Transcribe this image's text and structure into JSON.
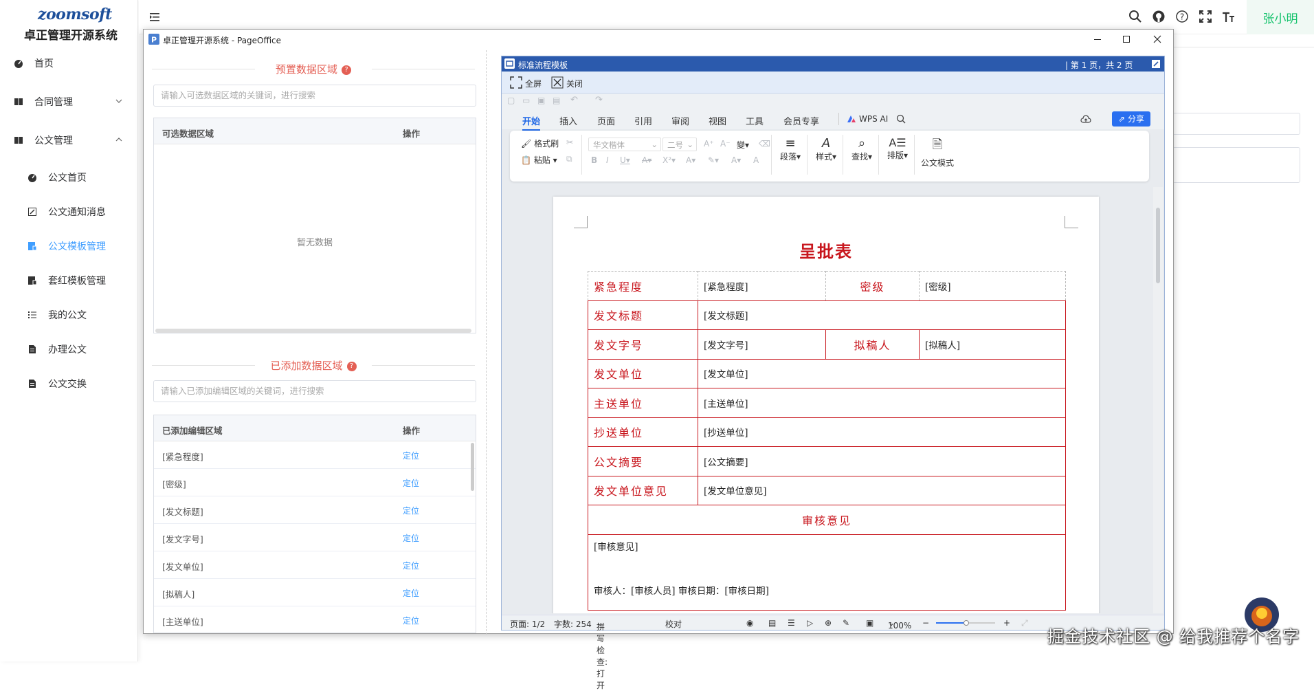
{
  "app": {
    "logo_text": "zoomsoft",
    "title": "卓正管理开源系统",
    "user_name": "张小明"
  },
  "sidebar": {
    "items": [
      {
        "label": "首页",
        "icon": "dashboard-icon"
      },
      {
        "label": "合同管理",
        "icon": "book-icon",
        "expandable": true,
        "expanded": false
      },
      {
        "label": "公文管理",
        "icon": "book-icon",
        "expandable": true,
        "expanded": true
      },
      {
        "label": "公文首页",
        "icon": "dashboard-icon",
        "sub": true
      },
      {
        "label": "公文通知消息",
        "icon": "edit-icon",
        "sub": true
      },
      {
        "label": "公文模板管理",
        "icon": "template-icon",
        "sub": true,
        "active": true
      },
      {
        "label": "套红模板管理",
        "icon": "template-icon",
        "sub": true
      },
      {
        "label": "我的公文",
        "icon": "list-icon",
        "sub": true
      },
      {
        "label": "办理公文",
        "icon": "document-icon",
        "sub": true
      },
      {
        "label": "公文交换",
        "icon": "document-icon",
        "sub": true
      }
    ]
  },
  "header": {
    "icons": [
      "menu-fold-icon",
      "search-icon",
      "github-icon",
      "help-icon",
      "fullscreen-icon",
      "font-size-icon"
    ]
  },
  "pageoffice": {
    "window_title": "卓正管理开源系统 - PageOffice",
    "preset": {
      "heading": "预置数据区域",
      "search_placeholder": "请输入可选数据区域的关键词，进行搜索",
      "col_name": "可选数据区域",
      "col_action": "操作",
      "empty_text": "暂无数据"
    },
    "added": {
      "heading": "已添加数据区域",
      "search_placeholder": "请输入已添加编辑区域的关键词，进行搜索",
      "col_name": "已添加编辑区域",
      "col_action": "操作",
      "rows": [
        {
          "name": "[紧急程度]",
          "action": "定位"
        },
        {
          "name": "[密级]",
          "action": "定位"
        },
        {
          "name": "[发文标题]",
          "action": "定位"
        },
        {
          "name": "[发文字号]",
          "action": "定位"
        },
        {
          "name": "[发文单位]",
          "action": "定位"
        },
        {
          "name": "[拟稿人]",
          "action": "定位"
        },
        {
          "name": "[主送单位]",
          "action": "定位"
        }
      ]
    }
  },
  "wps": {
    "doc_name": "标准流程模板",
    "page_info": "| 第 1 页，共 2 页",
    "fullscreen_label": "全屏",
    "close_label": "关闭",
    "tabs": [
      "开始",
      "插入",
      "页面",
      "引用",
      "审阅",
      "视图",
      "工具",
      "会员专享"
    ],
    "active_tab": "开始",
    "ai_label": "WPS AI",
    "share_label": "分享",
    "ribbon": {
      "format_painter": "格式刷",
      "paste": "粘贴",
      "font_name": "华文楷体",
      "font_size": "二号",
      "paragraph": "段落",
      "style": "样式",
      "find": "查找",
      "layout": "排版",
      "official_mode": "公文模式"
    },
    "document": {
      "title": "呈批表",
      "rows": [
        {
          "label": "紧急程度",
          "value": "[紧急程度]",
          "label2": "密级",
          "value2": "[密级]"
        },
        {
          "label": "发文标题",
          "value": "[发文标题]"
        },
        {
          "label": "发文字号",
          "value": "[发文字号]",
          "label2": "拟稿人",
          "value2": "[拟稿人]"
        },
        {
          "label": "发文单位",
          "value": "[发文单位]"
        },
        {
          "label": "主送单位",
          "value": "[主送单位]"
        },
        {
          "label": "抄送单位",
          "value": "[抄送单位]"
        },
        {
          "label": "公文摘要",
          "value": "[公文摘要]"
        },
        {
          "label": "发文单位意见",
          "value": "[发文单位意见]"
        }
      ],
      "review_heading": "审核意见",
      "review_value": "[审核意见]",
      "reviewer_line": "审核人：[审核人员] 审核日期：[审核日期]"
    },
    "status": {
      "page": "页面: 1/2",
      "words": "字数: 254",
      "spell": "拼写检查: 打开",
      "proof": "校对",
      "zoom": "100%"
    }
  },
  "watermark": "掘金技术社区 @ 给我推荐个名字",
  "colors": {
    "accent": "#409eff",
    "heading_red": "#e45f54",
    "doc_red": "#c8161d",
    "wps_blue": "#2b5aad",
    "user_green": "#13c26b"
  }
}
